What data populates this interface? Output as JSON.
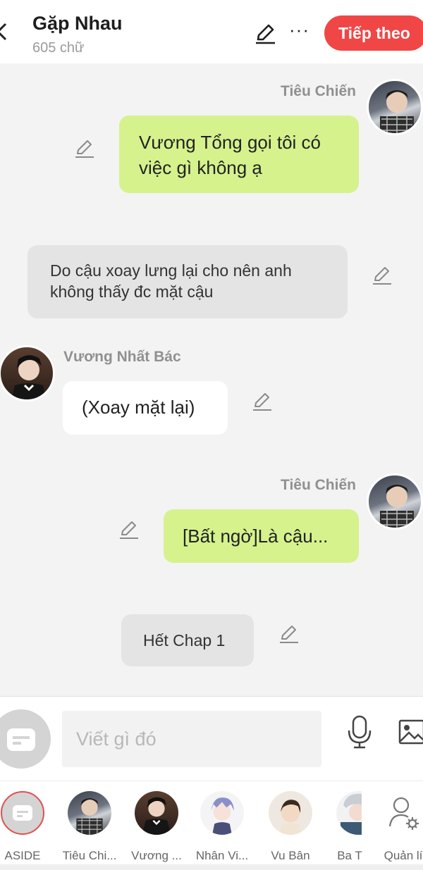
{
  "header": {
    "title": "Gặp Nhau",
    "word_count": "605 chữ",
    "next_label": "Tiếp theo"
  },
  "messages": [
    {
      "speaker": "Tiêu Chiến",
      "text": "Vương Tổng gọi tôi có việc gì không ạ"
    },
    {
      "text": "Do cậu xoay lưng lại cho nên anh không thấy đc mặt cậu"
    },
    {
      "speaker": "Vương Nhất Bác",
      "text": "(Xoay mặt lại)"
    },
    {
      "speaker": "Tiêu Chiến",
      "text": "[Bất ngờ]Là cậu..."
    },
    {
      "text": "Hết Chap 1"
    }
  ],
  "composer": {
    "placeholder": "Viết gì đó"
  },
  "characters": [
    {
      "label": "ASIDE"
    },
    {
      "label": "Tiêu Chi..."
    },
    {
      "label": "Vương ..."
    },
    {
      "label": "Nhân Vi..."
    },
    {
      "label": "Vu Bân"
    },
    {
      "label": "Ba T"
    },
    {
      "label": "Quản lí"
    }
  ],
  "colors": {
    "accent": "#f04646",
    "green_bubble": "#d6f28d",
    "background": "#f3f3f3"
  }
}
